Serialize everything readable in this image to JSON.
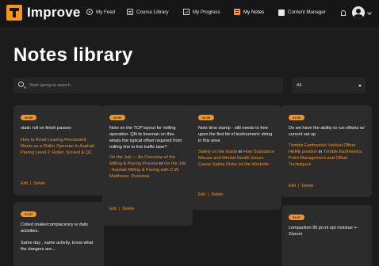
{
  "nav": {
    "logo": "Improve",
    "items": [
      {
        "label": "My Feed"
      },
      {
        "label": "Course Library"
      },
      {
        "label": "My Progress"
      },
      {
        "label": "My Notes"
      },
      {
        "label": "Content Manager"
      }
    ]
  },
  "page": {
    "title": "Notes library"
  },
  "search": {
    "placeholder": "Start typing to search"
  },
  "filter": {
    "value": "All"
  },
  "cards": [
    {
      "time": "00:35",
      "note": "static roll on finish passes",
      "link": "How to Avoid Leaving Permanent Marks as a Roller Operator in Asphalt Paving Level 2: Roller, Screed & QC",
      "edit": "Edit",
      "delete": "Delete"
    },
    {
      "time": "02:51",
      "note": "Note on the TCP layout for milling operation. QN to foreman on this- whats the typical offset required from milling line to live traffic lane?",
      "link_a": "On the Job — An Overview of the Milling & Paving Process",
      "in": "in",
      "link_b": "On the Job - Asphalt Milling & Paving with C.W. Matthews: Overview",
      "edit": "Edit",
      "delete": "Delete"
    },
    {
      "time": "01:29",
      "note": "Note time stamp - still needs to free upon the first bit of text/numeric string in this area",
      "link_a": "Safety on the Inside",
      "in": "in",
      "link_b": "How Substance Misuse and Mental Health Issues Cause Safety Risks on the Worksite",
      "edit": "Edit",
      "delete": "Delete"
    },
    {
      "time": "01:02",
      "note": "Do we have the ability to run offsets w/ current set up",
      "link_a": "Trimble Earthworks Vertical Offset HERE position",
      "in": "in",
      "link_b": "Trimble Earthworks: Point Management and Offset Techniques",
      "edit": "Edit",
      "delete": "Delete"
    },
    {
      "time": "01:57",
      "note": "Coiled snake/complacency w daily activities.",
      "note2": "Same day , same activity, know what the dangers are..."
    },
    {
      "time": "00:37",
      "note": "compaction 95 prcnt opt moistue +- 2/prcnt"
    }
  ]
}
